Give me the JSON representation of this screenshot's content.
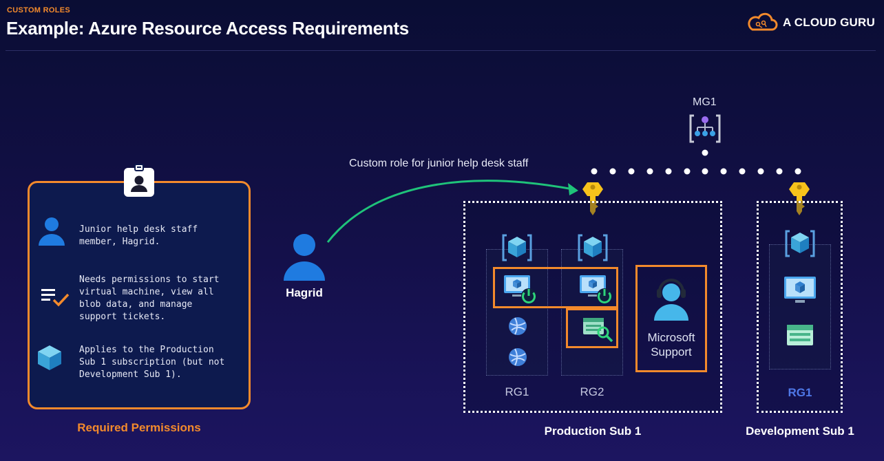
{
  "header": {
    "section_tag": "CUSTOM ROLES",
    "title": "Example: Azure Resource Access Requirements",
    "brand": "A CLOUD GURU"
  },
  "permissions_card": {
    "caption": "Required Permissions",
    "items": [
      {
        "icon": "user-icon",
        "lines": [
          "Junior help desk staff",
          "member, Hagrid."
        ]
      },
      {
        "icon": "checklist-icon",
        "lines": [
          "Needs permissions to start",
          "virtual machine, view all",
          "blob data, and manage",
          "support tickets."
        ]
      },
      {
        "icon": "cube-icon",
        "lines": [
          "Applies to the Production",
          "Sub 1 subscription (but not",
          "Development Sub 1)."
        ]
      }
    ]
  },
  "user": {
    "name": "Hagrid",
    "icon": "user-icon"
  },
  "arrow_label": "Custom role for junior help desk staff",
  "management_group": {
    "label": "MG1",
    "icon": "management-group-icon"
  },
  "production": {
    "label": "Production Sub 1",
    "rg1_label": "RG1",
    "rg2_label": "RG2",
    "support_label_line1": "Microsoft",
    "support_label_line2": "Support"
  },
  "development": {
    "label": "Development Sub 1",
    "rg1_label": "RG1"
  },
  "colors": {
    "accent_orange": "#f38a2c",
    "arrow_green": "#1fc37a",
    "dev_rg_blue": "#4f78e8",
    "key_gold": "#f7c21b"
  }
}
